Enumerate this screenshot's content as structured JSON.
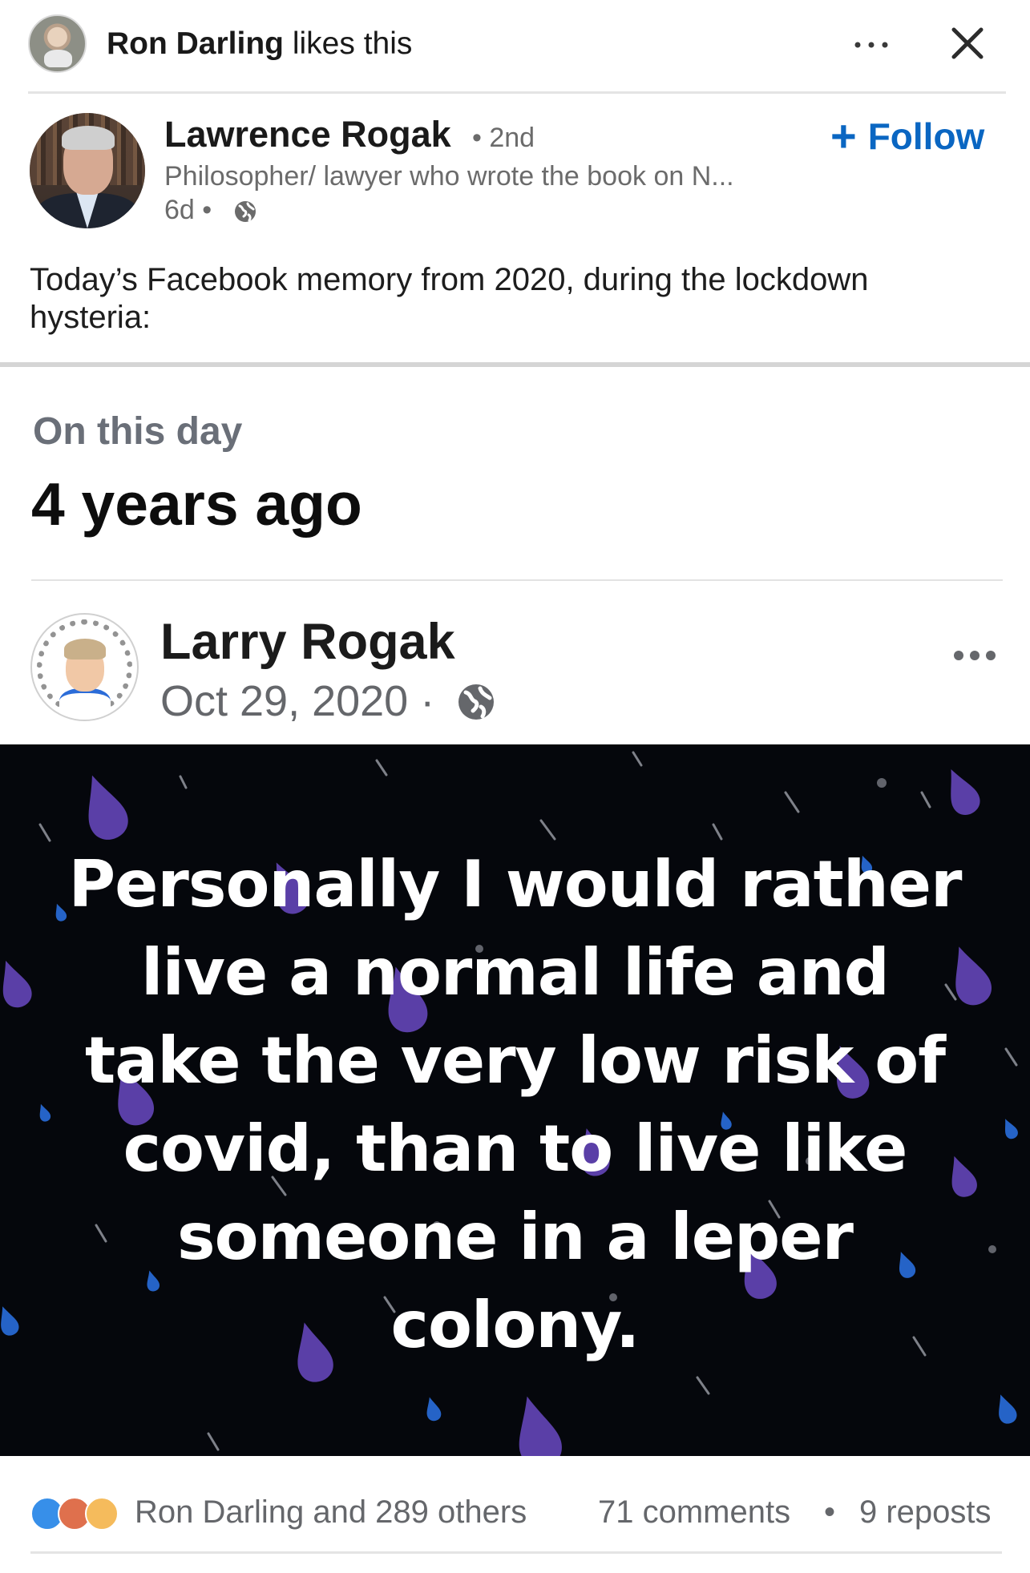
{
  "activity": {
    "liker_name": "Ron Darling",
    "liker_action": "likes this"
  },
  "author": {
    "name": "Lawrence Rogak",
    "degree": "• 2nd",
    "headline": "Philosopher/ lawyer who wrote the book on N...",
    "age": "6d •",
    "follow_label": "Follow"
  },
  "post": {
    "commentary": "Today’s Facebook memory from 2020, during the lockdown hysteria:"
  },
  "memory": {
    "on_this_day": "On this day",
    "years_ago": "4 years ago",
    "fb_name": "Larry Rogak",
    "fb_date": "Oct 29, 2020 ·",
    "quote": "Personally I would rather live a normal life and take the very low risk of covid, than to live like someone in a leper colony."
  },
  "stats": {
    "reactions_text": "Ron Darling and 289 others",
    "comments": "71 comments",
    "separator": "•",
    "reposts": "9 reposts"
  },
  "icons": {
    "like": "like-reaction-icon",
    "love": "love-reaction-icon",
    "insightful": "insightful-reaction-icon"
  },
  "colors": {
    "link_blue": "#0a66c2",
    "image_background": "#05070c",
    "secondary_text": "#65676b"
  }
}
